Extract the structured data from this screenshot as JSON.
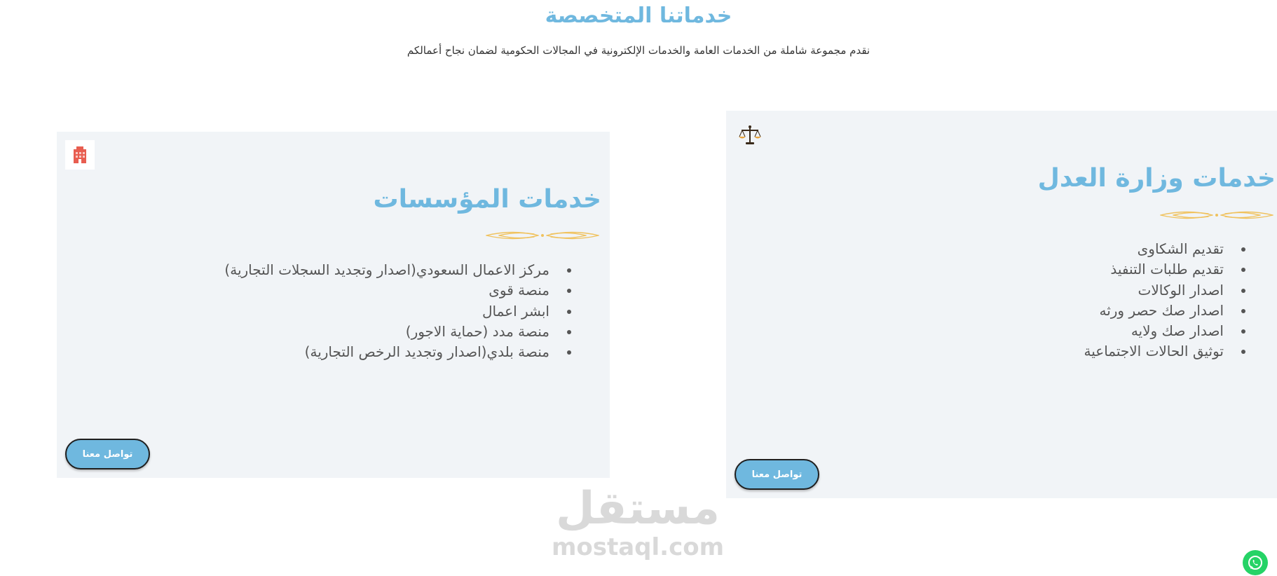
{
  "section": {
    "title": "خدماتنا المتخصصة",
    "subtitle": "نقدم مجموعة شاملة من الخدمات العامة والخدمات الإلكترونية في المجالات الحكومية لضمان نجاح أعمالكم"
  },
  "cards": [
    {
      "title": "خدمات وزارة العدل",
      "icon": "scales-of-justice-icon",
      "items": [
        "تقديم الشكاوى",
        "تقديم طلبات التنفيذ",
        "اصدار الوكالات",
        "اصدار صك حصر ورثه",
        "اصدار صك ولايه",
        "توثيق الحالات الاجتماعية"
      ],
      "button_label": "تواصل معنا"
    },
    {
      "title": "خدمات المؤسسات",
      "icon": "building-icon",
      "items": [
        "مركز الاعمال السعودي(اصدار وتجديد السجلات التجارية)",
        "منصة قوى",
        "ابشر اعمال",
        "منصة مدد (حماية الاجور)",
        "منصة بلدي(اصدار وتجديد الرخص التجارية)"
      ],
      "button_label": "تواصل معنا"
    }
  ],
  "watermark": {
    "arabic": "مستقل",
    "latin": "mostaql.com"
  },
  "floating": {
    "whatsapp_icon": "whatsapp-icon"
  },
  "colors": {
    "accent": "#6fb8df",
    "card_background": "#f1f4f7",
    "ornament": "#f0c25e",
    "building_icon": "#e85d50",
    "whatsapp": "#25d366"
  }
}
